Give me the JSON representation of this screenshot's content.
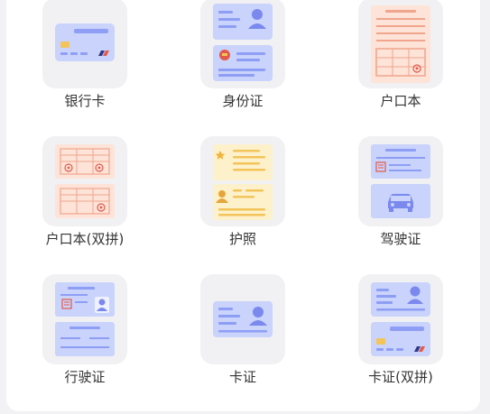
{
  "doc_types": [
    {
      "label": "银行卡",
      "icon": "bank-card-icon"
    },
    {
      "label": "身份证",
      "icon": "id-card-icon"
    },
    {
      "label": "户口本",
      "icon": "household-register-icon"
    },
    {
      "label": "户口本(双拼)",
      "icon": "household-register-double-icon"
    },
    {
      "label": "护照",
      "icon": "passport-icon"
    },
    {
      "label": "驾驶证",
      "icon": "driver-license-icon"
    },
    {
      "label": "行驶证",
      "icon": "vehicle-license-icon"
    },
    {
      "label": "卡证",
      "icon": "card-certificate-icon"
    },
    {
      "label": "卡证(双拼)",
      "icon": "card-certificate-double-icon"
    }
  ],
  "colors": {
    "blue_card": "#c9d3fb",
    "blue_line": "#8f9ef5",
    "blue_dark": "#7b88ee",
    "orange_card": "#fde3d8",
    "orange_line": "#f0a58c",
    "yellow_card": "#fdf1cc",
    "yellow_line": "#f3c45a",
    "red_mark": "#e25a4a"
  }
}
